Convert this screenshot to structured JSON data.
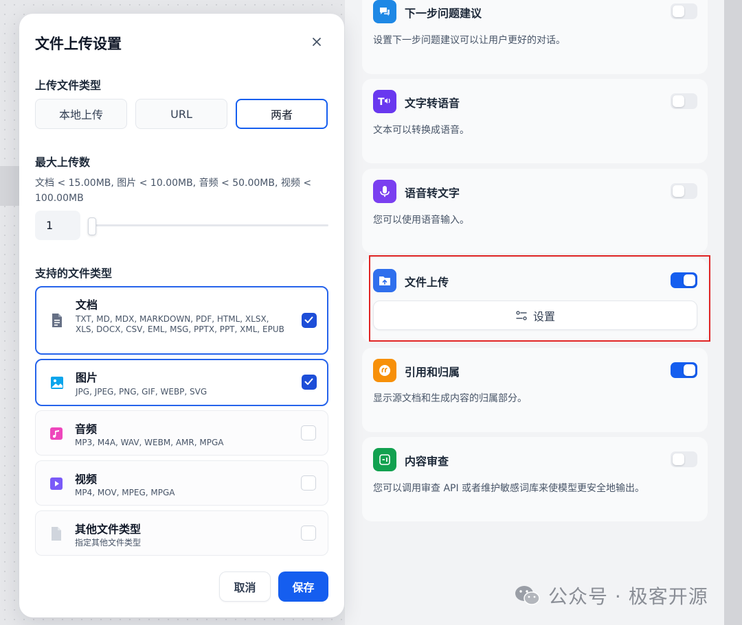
{
  "modal": {
    "title": "文件上传设置",
    "close_label": "×",
    "upload_type": {
      "label": "上传文件类型",
      "options": [
        "本地上传",
        "URL",
        "两者"
      ],
      "selected": "两者"
    },
    "max_upload": {
      "label": "最大上传数",
      "limits_text": "文档 < 15.00MB, 图片 < 10.00MB, 音频 < 50.00MB, 视频 < 100.00MB",
      "value": "1"
    },
    "file_types": {
      "label": "支持的文件类型",
      "items": [
        {
          "name": "文档",
          "desc": "TXT, MD, MDX, MARKDOWN, PDF, HTML, XLSX, XLS, DOCX, CSV, EML, MSG, PPTX, PPT, XML, EPUB",
          "checked": true
        },
        {
          "name": "图片",
          "desc": "JPG, JPEG, PNG, GIF, WEBP, SVG",
          "checked": true
        },
        {
          "name": "音频",
          "desc": "MP3, M4A, WAV, WEBM, AMR, MPGA",
          "checked": false
        },
        {
          "name": "视频",
          "desc": "MP4, MOV, MPEG, MPGA",
          "checked": false
        },
        {
          "name": "其他文件类型",
          "desc": "指定其他文件类型",
          "checked": false
        }
      ]
    },
    "cancel_label": "取消",
    "save_label": "保存"
  },
  "features": [
    {
      "title": "下一步问题建议",
      "desc": "设置下一步问题建议可以让用户更好的对话。",
      "enabled": false,
      "icon": "chat-bubbles-icon",
      "color": "#1e88e5"
    },
    {
      "title": "文字转语音",
      "desc": "文本可以转换成语音。",
      "enabled": false,
      "icon": "text-to-speech-icon",
      "color": "#6938ef"
    },
    {
      "title": "语音转文字",
      "desc": "您可以使用语音输入。",
      "enabled": false,
      "icon": "microphone-icon",
      "color": "#7a3ff0"
    },
    {
      "title": "文件上传",
      "settings_label": "设置",
      "enabled": true,
      "icon": "folder-upload-icon",
      "color": "#2f6fed"
    },
    {
      "title": "引用和归属",
      "desc": "显示源文档和生成内容的归属部分。",
      "enabled": true,
      "icon": "quote-icon",
      "color": "#f79009"
    },
    {
      "title": "内容审查",
      "desc": "您可以调用审查 API 或者维护敏感词库来使模型更安全地输出。",
      "enabled": false,
      "icon": "moderation-icon",
      "color": "#12a150"
    }
  ],
  "watermark": "公众号 · 极客开源"
}
